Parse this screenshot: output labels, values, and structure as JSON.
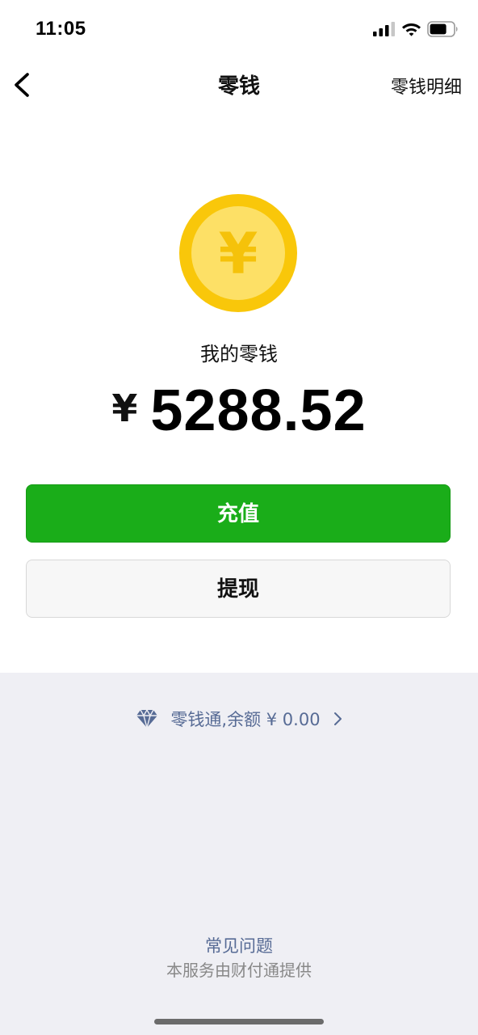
{
  "status_bar": {
    "time": "11:05",
    "icons": [
      "signal-icon",
      "wifi-icon",
      "battery-icon"
    ]
  },
  "nav": {
    "back_icon": "chevron-left-icon",
    "title": "零钱",
    "right_action": "零钱明细"
  },
  "balance": {
    "coin_icon": "yuan-coin-icon",
    "coin_symbol": "¥",
    "label": "我的零钱",
    "currency": "¥",
    "amount": "5288.52"
  },
  "actions": {
    "recharge_label": "充值",
    "withdraw_label": "提现"
  },
  "lingqiantong": {
    "icon": "diamond-icon",
    "text": "零钱通,余额 ¥ 0.00",
    "chevron": "chevron-right-icon"
  },
  "footer": {
    "faq": "常见问题",
    "provider": "本服务由财付通提供"
  },
  "colors": {
    "primary_green": "#1aad19",
    "link_blue": "#576b95",
    "coin_outer": "#f9c70a",
    "coin_inner": "#fde066",
    "bottom_bg": "#efeff4"
  }
}
